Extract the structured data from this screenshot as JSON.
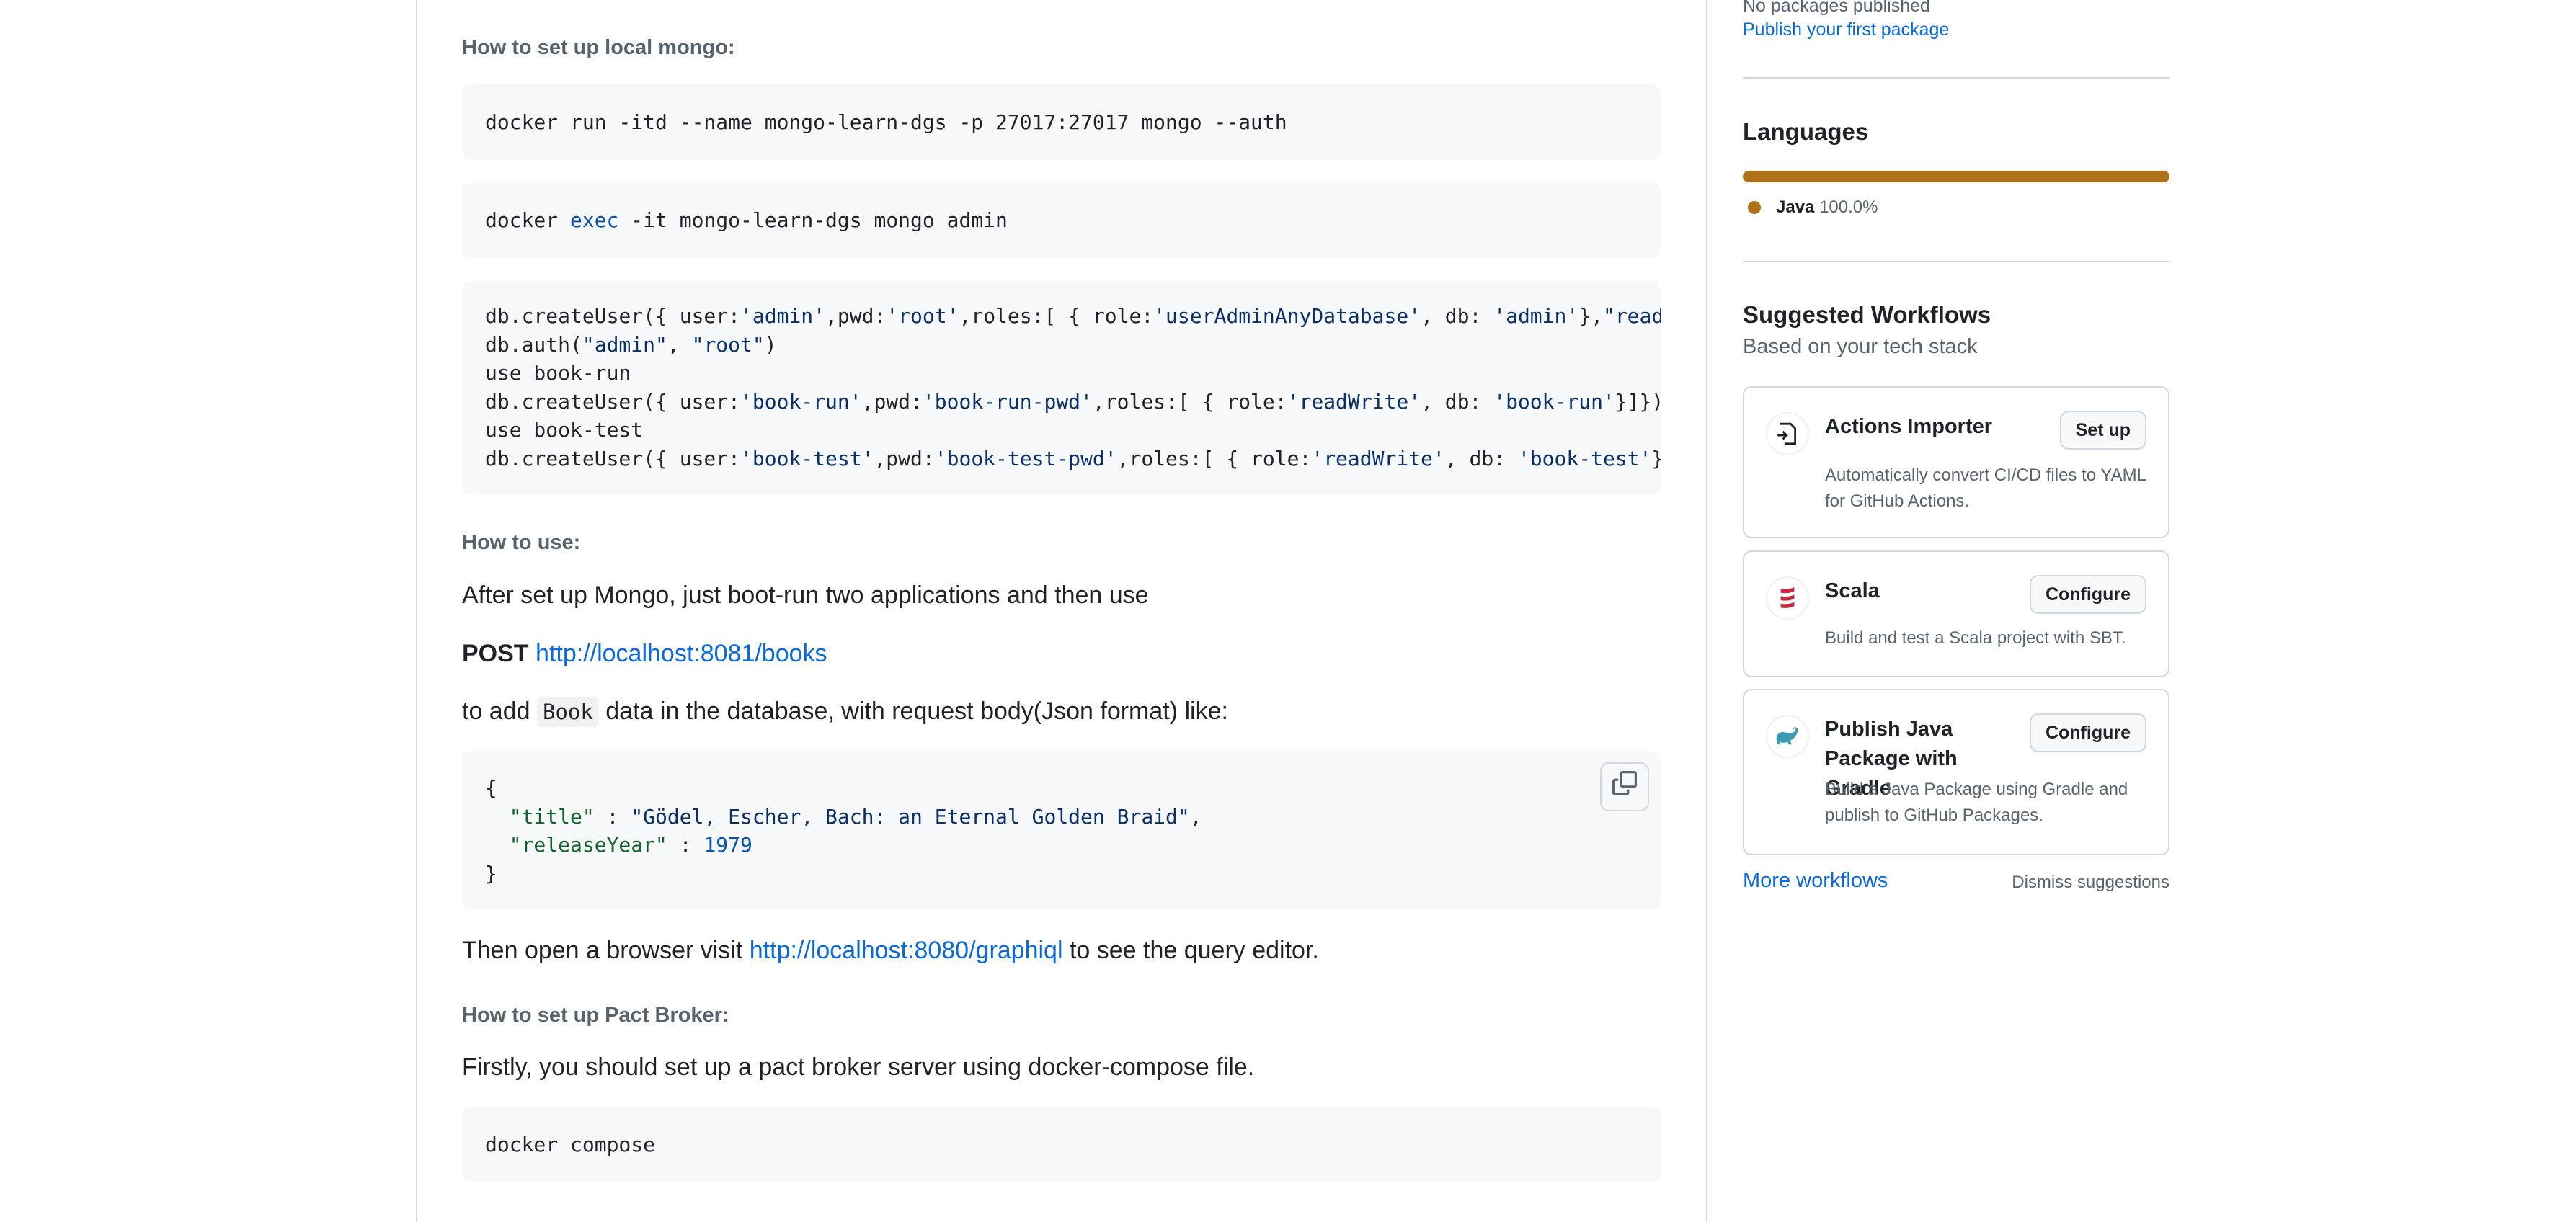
{
  "readme": {
    "heading_local_mongo": "How to set up local mongo:",
    "code1": {
      "cmd": "docker run -itd --name mongo-learn-dgs -p 27017:27017 mongo --auth"
    },
    "code2": {
      "pre": "docker ",
      "kw": "exec",
      "post": " -it mongo-learn-dgs mongo admin"
    },
    "code3": {
      "l1_a": "db.createUser({ user:",
      "l1_b": "'admin'",
      "l1_c": ",pwd:",
      "l1_d": "'root'",
      "l1_e": ",roles:[ { role:",
      "l1_f": "'userAdminAnyDatabase'",
      "l1_g": ", db: ",
      "l1_h": "'admin'",
      "l1_i": "},",
      "l1_j": "\"readWri",
      "l2_a": "db.auth(",
      "l2_b": "\"admin\"",
      "l2_c": ", ",
      "l2_d": "\"root\"",
      "l2_e": ")",
      "l3": "use book-run",
      "l4_a": "db.createUser({ user:",
      "l4_b": "'book-run'",
      "l4_c": ",pwd:",
      "l4_d": "'book-run-pwd'",
      "l4_e": ",roles:[ { role:",
      "l4_f": "'readWrite'",
      "l4_g": ", db: ",
      "l4_h": "'book-run'",
      "l4_i": "}]})",
      "l4_j": ";",
      "l5": "use book-test",
      "l6_a": "db.createUser({ user:",
      "l6_b": "'book-test'",
      "l6_c": ",pwd:",
      "l6_d": "'book-test-pwd'",
      "l6_e": ",roles:[ { role:",
      "l6_f": "'readWrite'",
      "l6_g": ", db: ",
      "l6_h": "'book-test'",
      "l6_i": "}]})"
    },
    "heading_how_to_use": "How to use:",
    "para_after_setup": "After set up Mongo, just boot-run two applications and then use",
    "post_label": "POST",
    "post_url": "http://localhost:8081/books",
    "add_pre": "to add ",
    "add_code": "Book",
    "add_post": " data in the database, with request body(Json format) like:",
    "json_code": {
      "open": "{",
      "title_key": "\"title\"",
      "title_sep": " : ",
      "title_val": "\"Gödel, Escher, Bach: an Eternal Golden Braid\"",
      "title_comma": ",",
      "year_key": "\"releaseYear\"",
      "year_sep": " : ",
      "year_val": "1979",
      "close": "}"
    },
    "browser_pre": "Then open a browser visit ",
    "browser_url": "http://localhost:8080/graphiql",
    "browser_post": " to see the query editor.",
    "heading_pact": "How to set up Pact Broker:",
    "para_pact": "Firstly, you should set up a pact broker server using docker-compose file.",
    "code_compose": "docker compose"
  },
  "sidebar": {
    "packages_status": "No packages published",
    "publish_link": "Publish your first package",
    "languages_heading": "Languages",
    "language_name": "Java",
    "language_percent": "100.0%",
    "workflows_heading": "Suggested Workflows",
    "workflows_sub": "Based on your tech stack",
    "cards": [
      {
        "title": "Actions Importer",
        "desc": "Automatically convert CI/CD files to YAML for GitHub Actions.",
        "button": "Set up",
        "icon": "actions-importer-icon"
      },
      {
        "title": "Scala",
        "desc": "Build and test a Scala project with SBT.",
        "button": "Configure",
        "icon": "scala-icon"
      },
      {
        "title": "Publish Java Package with Gradle",
        "desc": "Build a Java Package using Gradle and publish to GitHub Packages.",
        "button": "Configure",
        "icon": "gradle-icon"
      }
    ],
    "more_workflows": "More workflows",
    "dismiss": "Dismiss suggestions"
  },
  "colors": {
    "link": "#0969da",
    "java": "#b07219",
    "border": "#d0d7de",
    "code_bg": "#f6f8fa"
  }
}
